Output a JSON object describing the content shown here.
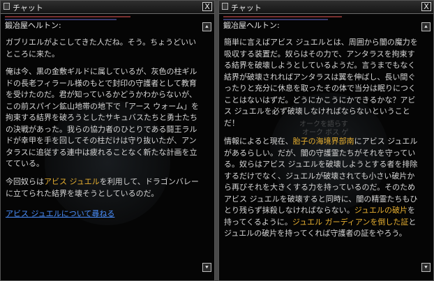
{
  "left_window": {
    "title": "チャット",
    "close_label": "X",
    "npc_name": "鍛冶屋ヘルトン:",
    "para1": "ガブリエルがよこしてきた人だね。そう。ちょうどいいところに来た。",
    "para2": "俺は今、黒の金敷ギルドに属しているが、灰色の柱ギルドの長老フィラール様のもとで封印の守護者として教育を受けたのだ。君が知っているかどうかわからないが、この前スパイン鉱山地帯の地下で「アース ウォーム」を拘束する結界を破ろうとしたサキュバスたちと勇士たちの決戦があった。我らの協力者のひとりである鬪王ラルドが幸甲を手を回してその柱だけは守り抜いたが、アンタラスに追従する連中は疲れることなく新たな計画を立てている。",
    "para3_before": "今回奴らは",
    "para3_highlight": "アビス ジュエル",
    "para3_after": "を利用して、ドラゴンバレーに立てられた結界を壊そうとしているのだ。",
    "link": "アビス ジュエルについて尋ねる",
    "scroll_up": "⯅",
    "scroll_down": "⯆"
  },
  "right_window": {
    "title": "チャット",
    "close_label": "X",
    "npc_name": "鍛冶屋ヘルトン:",
    "para1": "簡単に言えばアビス ジュエルとは、周囲から闇の魔力を吸収する装置だ。奴らはその力で、アンタラスを拘束する結界を破壊しようとしているようだ。言うまでもなく結界が破壊されればアンタラスは翼を伸ばし、長い間ぐったりと充分に休息を取ったその体で当分は眠りにつくことはないはずだ。どうにかこうにかできるかな？アビス ジュエルを必ず破壊しなければならないということだ！",
    "para2_a": "情報によると現在、",
    "para2_hl1": "胎子の海境界部南",
    "para2_b": "にアビス ジュエルがあるらしい。だが、闇の守護霊たちがそれを守っている。奴らはアビス ジュエルを破壊しようとする者を排除するだけでなく、ジュエルが破壊されても小さい破片から再びそれを大きくする力を持っているのだ。そのためアビス ジュエルを破壊すると同時に、闇の精霊たちもひとり残らず抹殺しなければならない。",
    "para2_hl2": "ジュエルの破片",
    "para2_c": "を持ってくるように。",
    "para2_hl3": "ジュエル ガーディアンを倒した証",
    "para2_d": "とジュエルの破片を持ってくれば守護者の証をやろう。",
    "ghost_text_1": "オークを語らす",
    "ghost_text_2": "オーク ボス ゲ",
    "scroll_up": "⯅",
    "scroll_down": "⯆"
  }
}
